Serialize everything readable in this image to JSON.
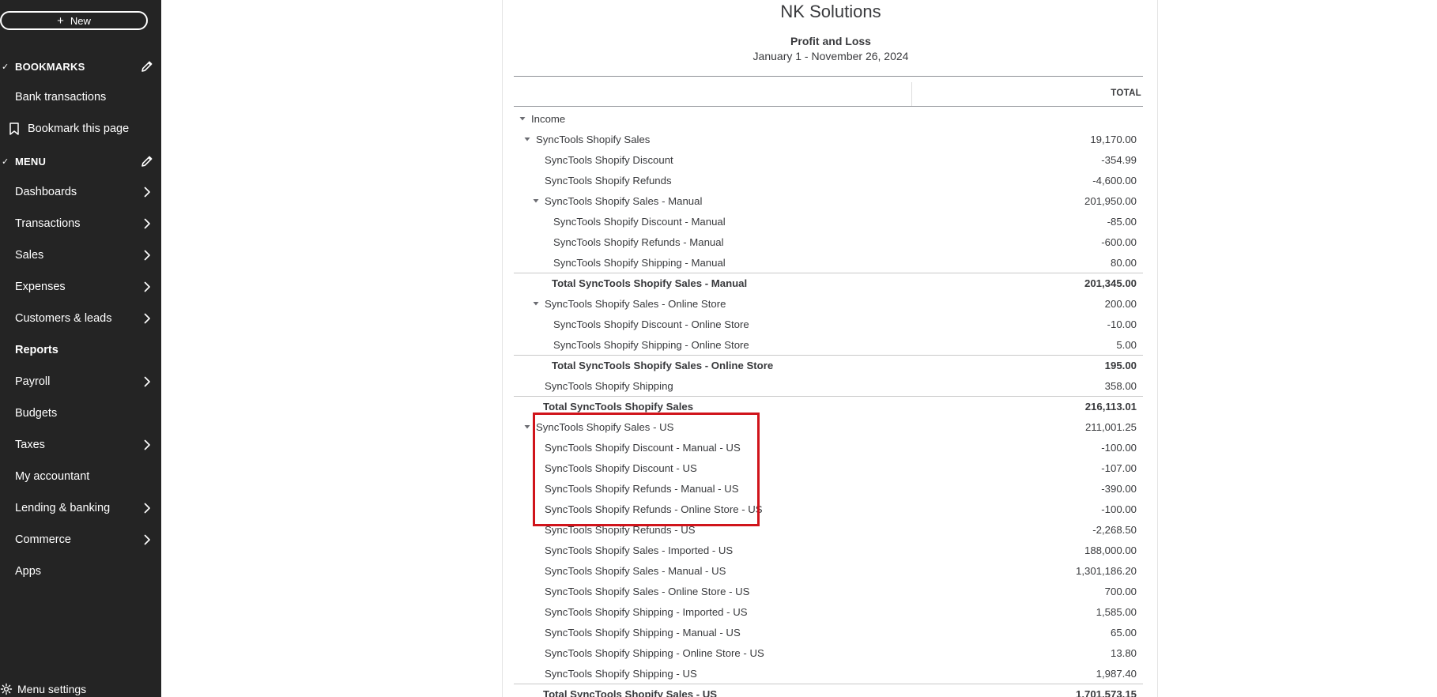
{
  "sidebar": {
    "new_label": "New",
    "bookmarks_header": "BOOKMARKS",
    "bookmark_items": [
      "Bank transactions",
      "Bookmark this page"
    ],
    "menu_header": "MENU",
    "menu_items": [
      {
        "label": "Dashboards",
        "has_chevron": true
      },
      {
        "label": "Transactions",
        "has_chevron": true
      },
      {
        "label": "Sales",
        "has_chevron": true
      },
      {
        "label": "Expenses",
        "has_chevron": true
      },
      {
        "label": "Customers & leads",
        "has_chevron": true
      },
      {
        "label": "Reports",
        "has_chevron": false,
        "active": true
      },
      {
        "label": "Payroll",
        "has_chevron": true
      },
      {
        "label": "Budgets",
        "has_chevron": false
      },
      {
        "label": "Taxes",
        "has_chevron": true
      },
      {
        "label": "My accountant",
        "has_chevron": false
      },
      {
        "label": "Lending & banking",
        "has_chevron": true
      },
      {
        "label": "Commerce",
        "has_chevron": true
      },
      {
        "label": "Apps",
        "has_chevron": false
      }
    ],
    "settings_label": "Menu settings",
    "background": "#242424"
  },
  "report": {
    "company": "NK Solutions",
    "title": "Profit and Loss",
    "date_range": "January 1 - November 26, 2024",
    "column_header": "TOTAL",
    "rows": [
      {
        "label": "Income",
        "amount": "",
        "level": 0,
        "caret": true,
        "type": "group"
      },
      {
        "label": "SyncTools Shopify Sales",
        "amount": "19,170.00",
        "level": 1,
        "caret": true,
        "type": "group"
      },
      {
        "label": "SyncTools Shopify Discount",
        "amount": "-354.99",
        "level": 2,
        "caret": false,
        "type": "item"
      },
      {
        "label": "SyncTools Shopify Refunds",
        "amount": "-4,600.00",
        "level": 2,
        "caret": false,
        "type": "item"
      },
      {
        "label": "SyncTools Shopify Sales - Manual",
        "amount": "201,950.00",
        "level": 2,
        "caret": true,
        "type": "group"
      },
      {
        "label": "SyncTools Shopify Discount - Manual",
        "amount": "-85.00",
        "level": 3,
        "caret": false,
        "type": "item"
      },
      {
        "label": "SyncTools Shopify Refunds - Manual",
        "amount": "-600.00",
        "level": 3,
        "caret": false,
        "type": "item"
      },
      {
        "label": "SyncTools Shopify Shipping - Manual",
        "amount": "80.00",
        "level": 3,
        "caret": false,
        "type": "item"
      },
      {
        "label": "Total SyncTools Shopify Sales - Manual",
        "amount": "201,345.00",
        "level": 3,
        "caret": false,
        "type": "total"
      },
      {
        "label": "SyncTools Shopify Sales - Online Store",
        "amount": "200.00",
        "level": 2,
        "caret": true,
        "type": "group"
      },
      {
        "label": "SyncTools Shopify Discount - Online Store",
        "amount": "-10.00",
        "level": 3,
        "caret": false,
        "type": "item"
      },
      {
        "label": "SyncTools Shopify Shipping - Online Store",
        "amount": "5.00",
        "level": 3,
        "caret": false,
        "type": "item"
      },
      {
        "label": "Total SyncTools Shopify Sales - Online Store",
        "amount": "195.00",
        "level": 3,
        "caret": false,
        "type": "total"
      },
      {
        "label": "SyncTools Shopify Shipping",
        "amount": "358.00",
        "level": 2,
        "caret": false,
        "type": "item"
      },
      {
        "label": "Total SyncTools Shopify Sales",
        "amount": "216,113.01",
        "level": 2,
        "caret": false,
        "type": "total"
      },
      {
        "label": "SyncTools Shopify Sales - US",
        "amount": "211,001.25",
        "level": 1,
        "caret": true,
        "type": "group"
      },
      {
        "label": "SyncTools Shopify Discount - Manual - US",
        "amount": "-100.00",
        "level": 2,
        "caret": false,
        "type": "item"
      },
      {
        "label": "SyncTools Shopify Discount - US",
        "amount": "-107.00",
        "level": 2,
        "caret": false,
        "type": "item"
      },
      {
        "label": "SyncTools Shopify Refunds - Manual - US",
        "amount": "-390.00",
        "level": 2,
        "caret": false,
        "type": "item"
      },
      {
        "label": "SyncTools Shopify Refunds - Online Store - US",
        "amount": "-100.00",
        "level": 2,
        "caret": false,
        "type": "item"
      },
      {
        "label": "SyncTools Shopify Refunds - US",
        "amount": "-2,268.50",
        "level": 2,
        "caret": false,
        "type": "item"
      },
      {
        "label": "SyncTools Shopify Sales - Imported - US",
        "amount": "188,000.00",
        "level": 2,
        "caret": false,
        "type": "item"
      },
      {
        "label": "SyncTools Shopify Sales - Manual - US",
        "amount": "1,301,186.20",
        "level": 2,
        "caret": false,
        "type": "item"
      },
      {
        "label": "SyncTools Shopify Sales - Online Store - US",
        "amount": "700.00",
        "level": 2,
        "caret": false,
        "type": "item"
      },
      {
        "label": "SyncTools Shopify Shipping - Imported - US",
        "amount": "1,585.00",
        "level": 2,
        "caret": false,
        "type": "item"
      },
      {
        "label": "SyncTools Shopify Shipping - Manual - US",
        "amount": "65.00",
        "level": 2,
        "caret": false,
        "type": "item"
      },
      {
        "label": "SyncTools Shopify Shipping - Online Store - US",
        "amount": "13.80",
        "level": 2,
        "caret": false,
        "type": "item"
      },
      {
        "label": "SyncTools Shopify Shipping - US",
        "amount": "1,987.40",
        "level": 2,
        "caret": false,
        "type": "item"
      },
      {
        "label": "Total SyncTools Shopify Sales - US",
        "amount": "1,701,573.15",
        "level": 2,
        "caret": false,
        "type": "total"
      }
    ]
  },
  "highlight_color": "#d0141b"
}
